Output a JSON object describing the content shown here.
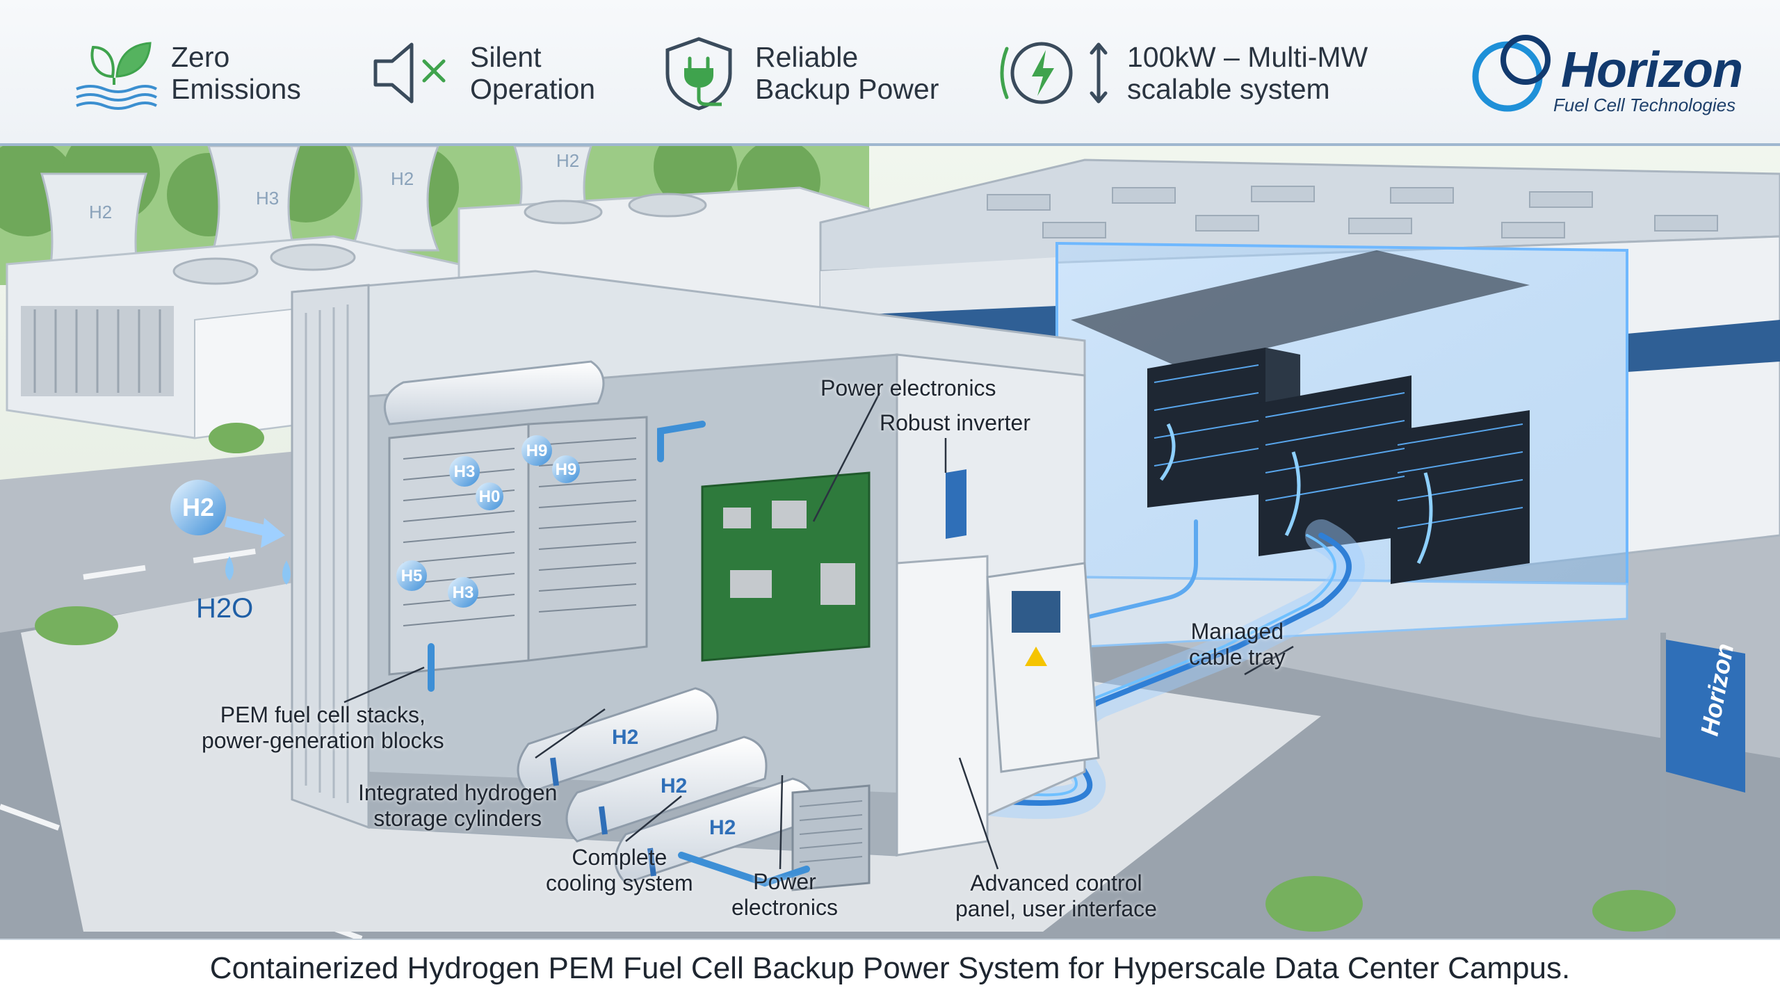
{
  "features": [
    {
      "line1": "Zero",
      "line2": "Emissions",
      "icon": "leaf-water-icon"
    },
    {
      "line1": "Silent",
      "line2": "Operation",
      "icon": "speaker-mute-icon"
    },
    {
      "line1": "Reliable",
      "line2": "Backup Power",
      "icon": "shield-plug-icon"
    },
    {
      "line1": "100kW – Multi-MW",
      "line2": "scalable system",
      "icon": "power-scale-icon"
    }
  ],
  "logo": {
    "name": "Horizon",
    "sub": "Fuel Cell Technologies"
  },
  "flag_text": "Horizon",
  "scene_labels": {
    "h2": "H2",
    "h2o": "H2O",
    "tanks": [
      "H2",
      "H2",
      "H2"
    ],
    "cooling_towers": [
      "H2",
      "H3",
      "H2",
      "H2"
    ],
    "bubbles": [
      "H3",
      "H9",
      "H9",
      "H0",
      "H5",
      "H3"
    ]
  },
  "callouts": {
    "power_electronics_top": "Power electronics",
    "robust_inverter": "Robust inverter",
    "managed_cable_tray": [
      "Managed",
      "cable tray"
    ],
    "pem_stacks": [
      "PEM fuel cell stacks,",
      "power-generation blocks"
    ],
    "storage_cylinders": [
      "Integrated hydrogen",
      "storage cylinders"
    ],
    "cooling_system": [
      "Complete",
      "cooling system"
    ],
    "power_electronics_bottom": [
      "Power",
      "electronics"
    ],
    "control_panel": [
      "Advanced control",
      "panel, user interface"
    ]
  },
  "caption": "Containerized Hydrogen PEM Fuel Cell Backup Power System for Hyperscale Data Center Campus.",
  "colors": {
    "accent": "#1f6fb8",
    "brand": "#123a6e",
    "green": "#3fa34d",
    "glow": "#4aa8ff"
  }
}
